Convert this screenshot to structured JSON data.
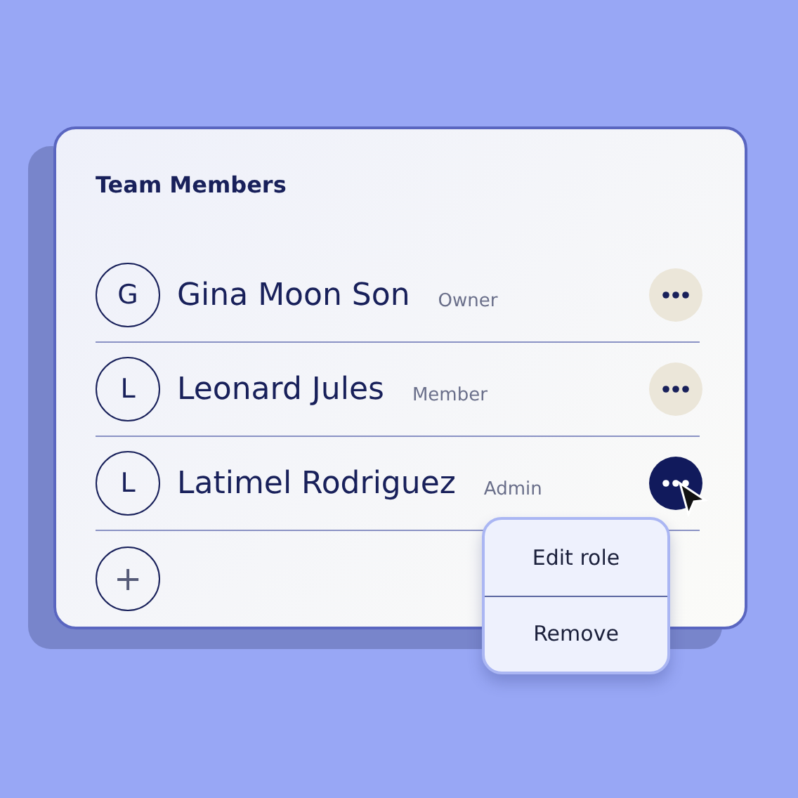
{
  "card": {
    "title": "Team Members"
  },
  "members": [
    {
      "initial": "G",
      "name": "Gina Moon Son",
      "role": "Owner",
      "active": false
    },
    {
      "initial": "L",
      "name": "Leonard Jules",
      "role": "Member",
      "active": false
    },
    {
      "initial": "L",
      "name": "Latimel Rodriguez",
      "role": "Admin",
      "active": true
    }
  ],
  "add_button": {
    "label": "+"
  },
  "menu": {
    "items": [
      "Edit role",
      "Remove"
    ]
  }
}
